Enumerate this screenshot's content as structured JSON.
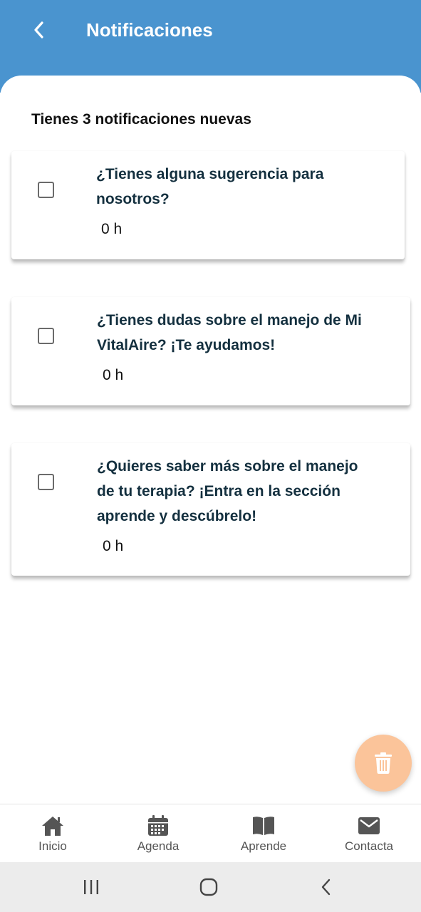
{
  "header": {
    "title": "Notificaciones"
  },
  "summary": {
    "text": "Tienes 3 notificaciones nuevas"
  },
  "notifications": [
    {
      "text": "¿Tienes alguna sugerencia para nosotros?",
      "time": "0 h"
    },
    {
      "text": "¿Tienes dudas sobre el manejo de Mi VitalAire? ¡Te ayudamos!",
      "time": "0 h"
    },
    {
      "text": "¿Quieres saber más sobre el manejo de tu terapia? ¡Entra en la sección aprende y descúbrelo!",
      "time": "0 h"
    }
  ],
  "bottom_nav": [
    {
      "label": "Inicio",
      "icon": "home-icon"
    },
    {
      "label": "Agenda",
      "icon": "calendar-icon"
    },
    {
      "label": "Aprende",
      "icon": "book-icon"
    },
    {
      "label": "Contacta",
      "icon": "mail-icon"
    }
  ],
  "colors": {
    "header": "#4a94cf",
    "fab": "#fbc49a",
    "card_text": "#14303f"
  },
  "icons": {
    "back": "chevron-left-icon",
    "fab": "trash-icon"
  }
}
